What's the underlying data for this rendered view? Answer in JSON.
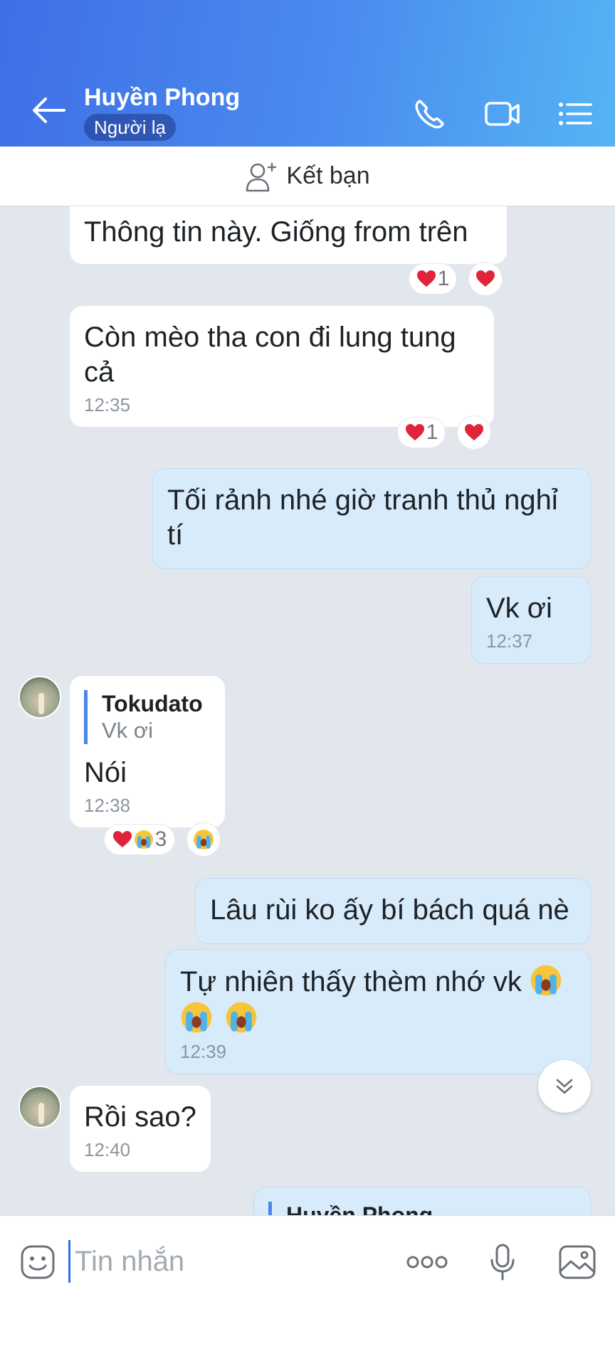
{
  "header": {
    "title": "Huyền Phong",
    "badge": "Người lạ"
  },
  "friend_bar": {
    "label": "Kết bạn"
  },
  "messages": [
    {
      "text": "Thông tin này.  Giống from trên",
      "reaction_count": "1"
    },
    {
      "text": "Còn mèo tha con đi lung tung cả",
      "time": "12:35",
      "reaction_count": "1"
    },
    {
      "text": "Tối rảnh nhé giờ tranh thủ nghỉ tí"
    },
    {
      "text": "Vk ơi",
      "time": "12:37"
    },
    {
      "quote_name": "Tokudato",
      "quote_text": "Vk ơi",
      "text": "Nói",
      "time": "12:38",
      "reaction_count": "3"
    },
    {
      "text": "Lâu rùi ko ấy bí bách quá nè"
    },
    {
      "text": "Tự nhiên thấy thèm nhớ vk",
      "time": "12:39"
    },
    {
      "text": "Rồi sao?",
      "time": "12:40"
    },
    {
      "quote_name": "Huyền Phong"
    }
  ],
  "composer": {
    "placeholder": "Tin nhắn"
  },
  "colors": {
    "header_start": "#3f6fe6",
    "header_end": "#55b4f4",
    "outgoing": "#d8ebfb",
    "incoming": "#ffffff",
    "background": "#e2e7ee"
  }
}
